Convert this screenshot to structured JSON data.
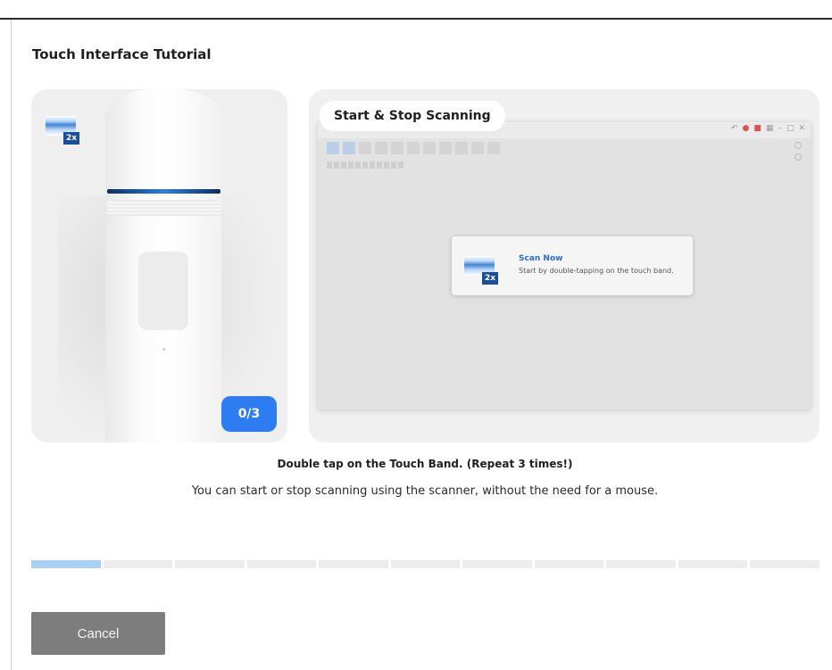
{
  "dialog": {
    "title": "Touch Interface Tutorial"
  },
  "scanner_panel": {
    "tap_icon_badge": "2x",
    "counter": "0/3",
    "tap_icon_name": "double-tap-icon"
  },
  "preview_panel": {
    "title": "Start & Stop Scanning",
    "scan_card": {
      "badge": "2x",
      "title": "Scan Now",
      "description": "Start by double-tapping on the touch band."
    }
  },
  "instruction": {
    "title": "Double tap on the Touch Band. (Repeat 3 times!)",
    "description": "You can start or stop scanning using the scanner, without the need for a mouse."
  },
  "progress": {
    "total_steps": 11,
    "current_step": 1
  },
  "actions": {
    "cancel_label": "Cancel"
  },
  "colors": {
    "accent": "#2d7cf1",
    "progress_active": "#a9d0f5",
    "progress_inactive": "#ececec",
    "cancel_button": "#7d7d7d"
  }
}
